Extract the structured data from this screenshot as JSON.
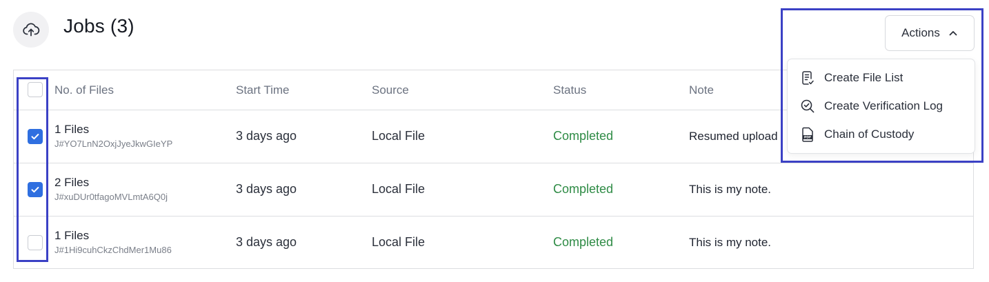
{
  "page": {
    "title": "Jobs (3)",
    "header_icon": "cloud-upload-icon"
  },
  "actions": {
    "label": "Actions",
    "chevron_icon": "chevron-up-icon",
    "menu": [
      {
        "label": "Create File List",
        "icon": "file-check-icon"
      },
      {
        "label": "Create Verification Log",
        "icon": "search-check-icon"
      },
      {
        "label": "Chain of Custody",
        "icon": "pdf-file-icon"
      }
    ]
  },
  "table": {
    "headers": {
      "files": "No. of Files",
      "start_time": "Start Time",
      "source": "Source",
      "status": "Status",
      "note": "Note"
    },
    "rows": [
      {
        "checked": true,
        "files": "1 Files",
        "job_id": "J#YO7LnN2OxjJyeJkwGIeYP",
        "start_time": "3 days ago",
        "source": "Local File",
        "status": "Completed",
        "note": "Resumed upload"
      },
      {
        "checked": true,
        "files": "2 Files",
        "job_id": "J#xuDUr0tfagoMVLmtA6Q0j",
        "start_time": "3 days ago",
        "source": "Local File",
        "status": "Completed",
        "note": "This is my note."
      },
      {
        "checked": false,
        "files": "1 Files",
        "job_id": "J#1Hi9cuhCkzChdMer1Mu86",
        "start_time": "3 days ago",
        "source": "Local File",
        "status": "Completed",
        "note": "This is my note."
      }
    ]
  },
  "colors": {
    "accent": "#2f6fe0",
    "status_completed": "#2e8b45",
    "highlight": "#3b41c5"
  }
}
